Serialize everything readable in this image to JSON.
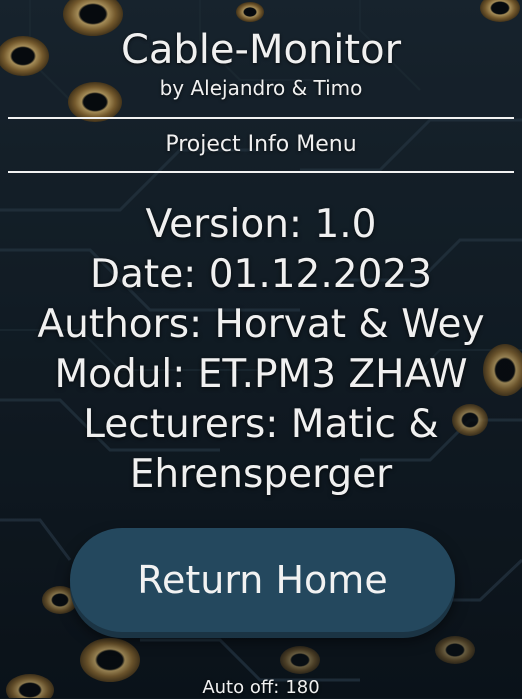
{
  "header": {
    "title": "Cable-Monitor",
    "subtitle": "by Alejandro & Timo"
  },
  "menu": {
    "title": "Project Info Menu"
  },
  "info": {
    "version": "Version: 1.0",
    "date": "Date: 01.12.2023",
    "authors": "Authors: Horvat & Wey",
    "module": "Modul: ET.PM3 ZHAW",
    "lecturers_line1": "Lecturers: Matic &",
    "lecturers_line2": "Ehrensperger"
  },
  "actions": {
    "return_home_label": "Return Home"
  },
  "footer": {
    "auto_off_label": "Auto off:",
    "auto_off_value": "180"
  },
  "colors": {
    "background": "#0f1820",
    "button": "#24485e",
    "text": "#f0f0f0",
    "gold_pads": "#b8924a"
  }
}
